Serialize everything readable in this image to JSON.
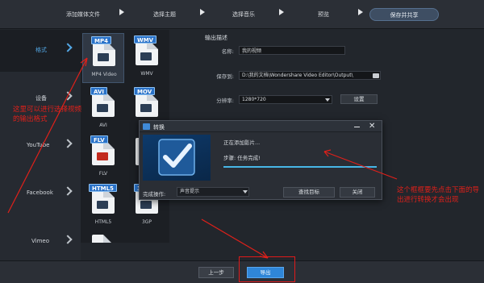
{
  "steps": [
    {
      "label": "添加媒体文件"
    },
    {
      "label": "选择主题"
    },
    {
      "label": "选择音乐"
    },
    {
      "label": "预览"
    },
    {
      "label": "保存并共享"
    }
  ],
  "categories": [
    {
      "label": "格式"
    },
    {
      "label": "设备"
    },
    {
      "label": "YouTube"
    },
    {
      "label": "Facebook"
    },
    {
      "label": "Vimeo"
    }
  ],
  "formats": [
    {
      "tag": "MP4",
      "name": "MP4 Video"
    },
    {
      "tag": "WMV",
      "name": "WMV"
    },
    {
      "tag": "AVI",
      "name": "AVI"
    },
    {
      "tag": "MOV",
      "name": ""
    },
    {
      "tag": "FLV",
      "name": "FLV"
    },
    {
      "tag": "",
      "name": ""
    },
    {
      "tag": "HTML5",
      "name": "HTML5"
    },
    {
      "tag": "3",
      "name": "3GP"
    }
  ],
  "settings": {
    "title": "输出描述",
    "name_label": "名称:",
    "name_value": "我的视频",
    "save_label": "保存到:",
    "save_value": "D:\\我的文档\\Wondershare Video Editor\\Output\\",
    "resolution_label": "分辨率:",
    "resolution_value": "1280*720",
    "settings_button": "设置"
  },
  "dialog": {
    "title": "转换",
    "status": "正在添加影片...",
    "step": "步骤: 任务完成!",
    "progress": 1.0,
    "after_label": "完成操作:",
    "after_value": "声音提示",
    "find_button": "查找目标",
    "close_button": "关闭"
  },
  "bottom": {
    "prev_label": "上一步",
    "export_label": "导出"
  },
  "annotations": {
    "left_note": "这里可以进行选择视频的输出格式",
    "right_note": "这个框框要先点击下面的导出进行转换才会出现"
  },
  "colors": {
    "annotation": "#e0201a",
    "accent": "#2f86d8",
    "active_text": "#53a8e6"
  }
}
